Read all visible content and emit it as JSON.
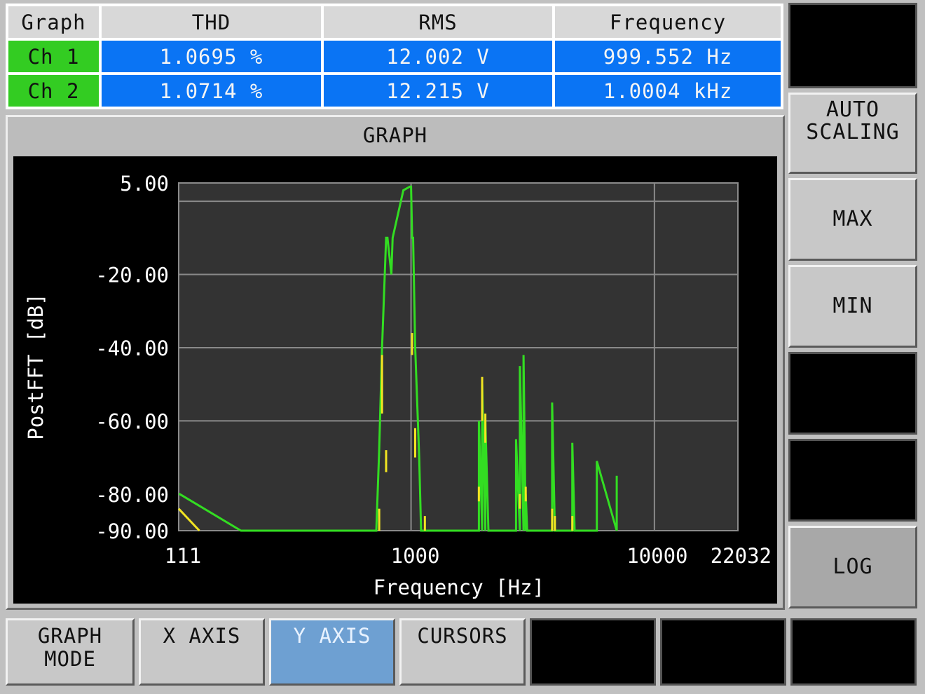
{
  "table": {
    "headers": [
      "Graph",
      "THD",
      "RMS",
      "Frequency"
    ],
    "rows": [
      {
        "channel": "Ch 1",
        "thd": "1.0695 %",
        "rms": "12.002 V",
        "frequency": "999.552 Hz"
      },
      {
        "channel": "Ch 2",
        "thd": "1.0714 %",
        "rms": "12.215 V",
        "frequency": "1.0004 kHz"
      }
    ]
  },
  "graph": {
    "title": "GRAPH"
  },
  "right_buttons": [
    {
      "label": ""
    },
    {
      "label": "AUTO\nSCALING"
    },
    {
      "label": "MAX"
    },
    {
      "label": "MIN"
    },
    {
      "label": ""
    },
    {
      "label": ""
    },
    {
      "label": "LOG"
    }
  ],
  "bottom_buttons": [
    {
      "label": "GRAPH\nMODE"
    },
    {
      "label": "X AXIS"
    },
    {
      "label": "Y AXIS"
    },
    {
      "label": "CURSORS"
    },
    {
      "label": ""
    },
    {
      "label": ""
    },
    {
      "label": ""
    }
  ],
  "colors": {
    "channel_bg": "#33cc22",
    "value_bg": "#0a74f4",
    "plot_bg": "#333333",
    "ch1_trace": "#33dd22",
    "ch2_trace": "#f2e422",
    "active_button": "#6ea0d2"
  },
  "chart_data": {
    "type": "line",
    "xlabel": "Frequency [Hz]",
    "ylabel": "PostFFT [dB]",
    "x_scale": "log",
    "xlim": [
      111,
      22032
    ],
    "ylim": [
      -90,
      5
    ],
    "x_tick_labels": [
      "111",
      "1000",
      "10000",
      "22032"
    ],
    "y_tick_labels": [
      "5.00",
      "-20.00",
      "-40.00",
      "-60.00",
      "-80.00",
      "-90.00"
    ],
    "y_tick_values": [
      5,
      -20,
      -40,
      -60,
      -80,
      -90
    ],
    "grid": true,
    "series": [
      {
        "color": "#33dd22",
        "x": [
          111,
          112,
          200,
          630,
          720,
          740,
          760,
          790,
          800,
          830,
          840,
          930,
          990,
          1000,
          1010,
          1020,
          1040,
          1080,
          1100,
          1120,
          1140,
          1150,
          1900,
          1900,
          1960,
          1960,
          2020,
          2020,
          2080,
          2080,
          2700,
          2700,
          2800,
          2800,
          2900,
          2900,
          2960,
          2960,
          3000,
          3000,
          3800,
          3800,
          3900,
          3900,
          4600,
          4600,
          4700,
          4700,
          5800,
          5800,
          7000,
          7000
        ],
        "y": [
          -80,
          -80,
          -90,
          -90,
          -90,
          -68,
          -40,
          -10,
          -10,
          -20,
          -10,
          3,
          4,
          4,
          -10,
          -10,
          -40,
          -70,
          -90,
          -90,
          -90,
          -90,
          -90,
          -60,
          -90,
          -50,
          -90,
          -60,
          -90,
          -90,
          -90,
          -65,
          -90,
          -45,
          -90,
          -42,
          -90,
          -80,
          -90,
          -90,
          -90,
          -55,
          -90,
          -90,
          -90,
          -66,
          -90,
          -90,
          -90,
          -71,
          -90,
          -75
        ]
      },
      {
        "color": "#f2e422",
        "x": [
          111,
          135
        ],
        "y": [
          -84,
          -90
        ]
      }
    ]
  }
}
